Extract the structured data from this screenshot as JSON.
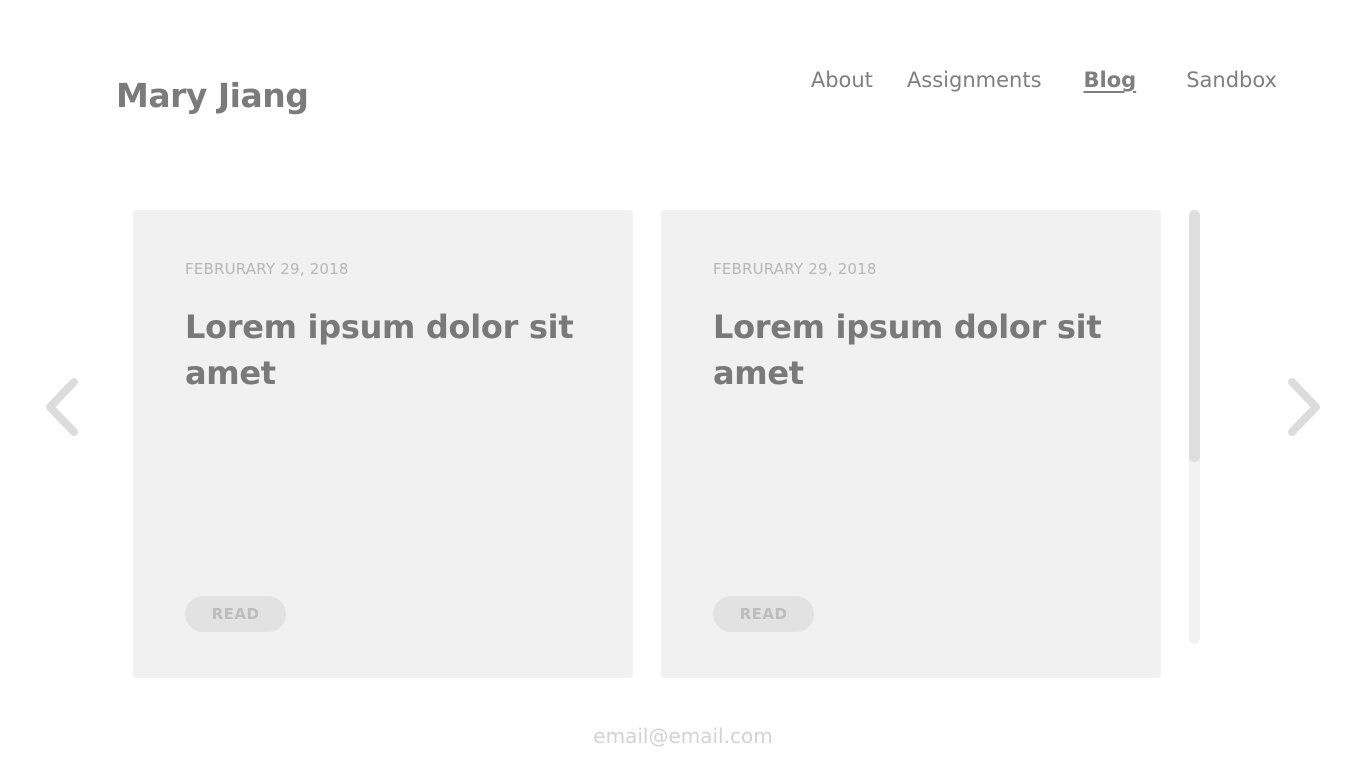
{
  "header": {
    "site_title": "Mary Jiang",
    "nav": [
      {
        "label": "About",
        "active": false
      },
      {
        "label": "Assignments",
        "active": false
      },
      {
        "label": "Blog",
        "active": true
      },
      {
        "label": "Sandbox",
        "active": false
      }
    ]
  },
  "carousel": {
    "prev_icon": "chevron-left-icon",
    "next_icon": "chevron-right-icon",
    "cards": [
      {
        "date": "FEBRURARY 29, 2018",
        "title": "Lorem ipsum dolor sit amet",
        "button_label": "READ"
      },
      {
        "date": "FEBRURARY 29, 2018",
        "title": "Lorem ipsum dolor sit amet",
        "button_label": "READ"
      }
    ]
  },
  "footer": {
    "email": "email@email.com"
  },
  "colors": {
    "text": "#7a7a7a",
    "card_background": "#f1f1f1",
    "button_background": "#e2e2e2",
    "arrow": "#dcdcdc"
  }
}
